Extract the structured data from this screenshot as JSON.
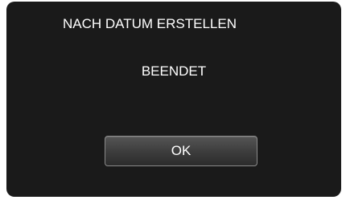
{
  "dialog": {
    "title": "NACH DATUM ERSTELLEN",
    "message": "BEENDET",
    "ok_label": "OK"
  },
  "colors": {
    "background": "#1a1a1a",
    "text": "#ffffff",
    "button_border": "#8a8a8a"
  }
}
